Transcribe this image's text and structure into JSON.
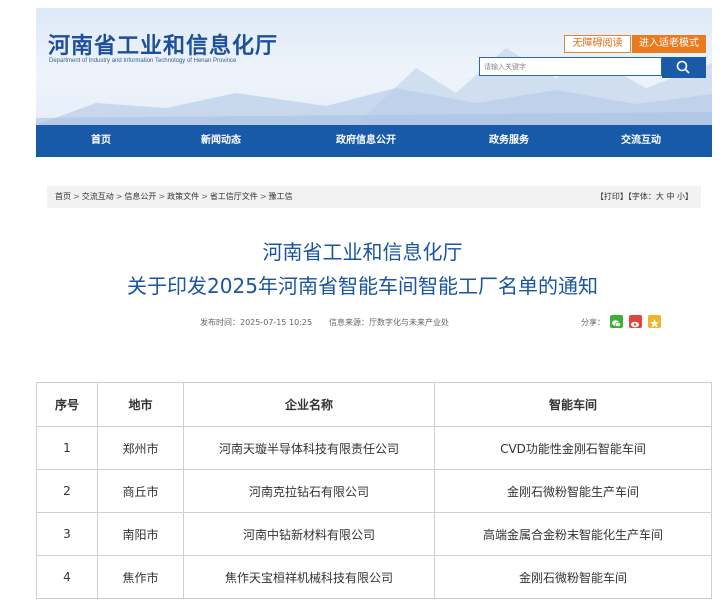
{
  "header": {
    "title": "河南省工业和信息化厅",
    "subtitle": "Department of Industry and Information Technology of Henan Province",
    "accessibility_label": "无障碍阅读",
    "elder_mode_label": "进入适老模式",
    "search_placeholder": "请输入关键字"
  },
  "nav": {
    "items": [
      "首页",
      "新闻动态",
      "政府信息公开",
      "政务服务",
      "交流互动"
    ]
  },
  "breadcrumb": {
    "items": [
      "首页",
      "交流互动",
      "信息公开",
      "政策文件",
      "省工信厅文件",
      "豫工信"
    ],
    "separator": ">",
    "tools": "【打印】【字体：大 中 小】"
  },
  "article": {
    "title_line1": "河南省工业和信息化厅",
    "title_line2": "关于印发2025年河南省智能车间智能工厂名单的通知",
    "publish_time": "发布时间：2025-07-15 10:25",
    "source": "信息来源：厅数字化与未来产业处",
    "share_label": "分享：",
    "share_icons": [
      "wechat-icon",
      "weibo-icon",
      "favorite-icon"
    ]
  },
  "table": {
    "headers": [
      "序号",
      "地市",
      "企业名称",
      "智能车间"
    ],
    "rows": [
      [
        "1",
        "郑州市",
        "河南天璇半导体科技有限责任公司",
        "CVD功能性金刚石智能车间"
      ],
      [
        "2",
        "商丘市",
        "河南克拉钻石有限公司",
        "金刚石微粉智能生产车间"
      ],
      [
        "3",
        "南阳市",
        "河南中钻新材料有限公司",
        "高端金属合金粉末智能化生产车间"
      ],
      [
        "4",
        "焦作市",
        "焦作天宝桓祥机械科技有限公司",
        "金刚石微粉智能车间"
      ]
    ]
  },
  "colors": {
    "brand_blue": "#1859a8",
    "title_blue": "#1a55a2",
    "orange": "#ea7a20"
  }
}
